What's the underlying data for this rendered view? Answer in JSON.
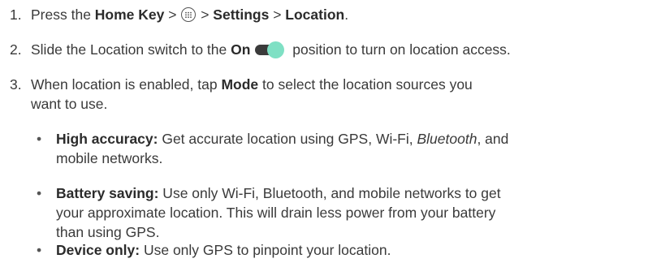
{
  "steps": [
    {
      "number": "1.",
      "pre": "Press the ",
      "home_key": "Home Key",
      "sep1": " > ",
      "sep2": " > ",
      "settings": "Settings",
      "sep3": " > ",
      "location": "Location",
      "end": "."
    },
    {
      "number": "2.",
      "pre": "Slide the Location switch to the ",
      "on": "On",
      "post": " position to turn on location access."
    },
    {
      "number": "3.",
      "pre": "When location is enabled, tap ",
      "mode": "Mode",
      "line1_post": " to select the location sources you",
      "line2": "want to use."
    }
  ],
  "bullets": [
    {
      "label": "High accuracy:",
      "line1_pre": " Get accurate location using GPS, Wi-Fi, ",
      "line1_italic": "Bluetooth",
      "line1_post": ", and",
      "line2": "mobile networks."
    },
    {
      "label": "Battery saving:",
      "line1": " Use only Wi-Fi, Bluetooth, and mobile networks to get",
      "line2": "your approximate location. This will drain less power from your battery",
      "line3": "than using GPS."
    },
    {
      "label": "Device only:",
      "line1": " Use only GPS to pinpoint your location."
    }
  ],
  "bullet_glyph": "•",
  "icons": {
    "apps": "apps-grid-icon",
    "toggle": "toggle-switch-on-icon"
  },
  "colors": {
    "text": "#3a3a3a",
    "toggle_track": "#3b3b3b",
    "toggle_knob": "#7fe0c4"
  }
}
